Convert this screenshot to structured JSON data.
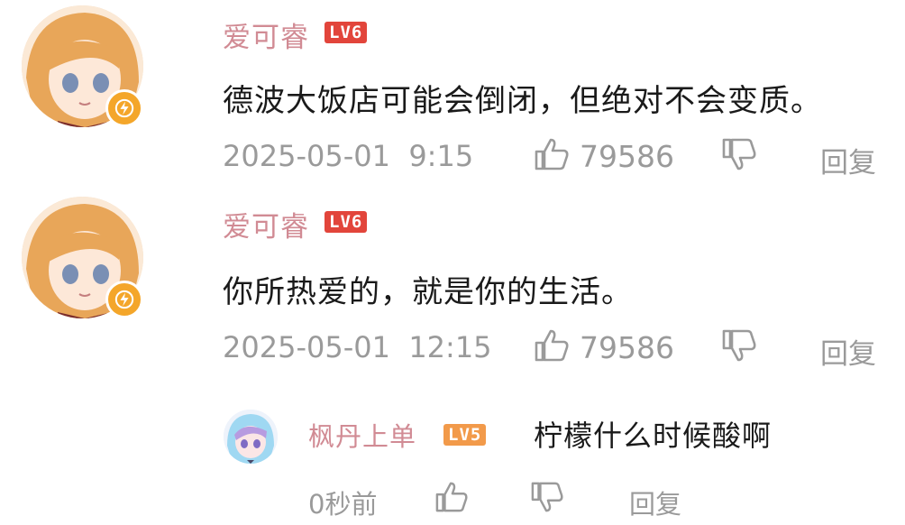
{
  "comments": [
    {
      "username": "爱可睿",
      "level": "LV6",
      "level_color": "#e2453b",
      "text": "德波大饭店可能会倒闭，但绝对不会变质。",
      "time": "2025-05-01  9:15",
      "likes": "79586",
      "reply_label": "回复"
    },
    {
      "username": "爱可睿",
      "level": "LV6",
      "level_color": "#e2453b",
      "text": "你所热爱的，就是你的生活。",
      "time": "2025-05-01  12:15",
      "likes": "79586",
      "reply_label": "回复"
    }
  ],
  "reply": {
    "username": "枫丹上单",
    "level": "LV5",
    "level_color": "#f29a4a",
    "text": "柠檬什么时候酸啊",
    "time": "0秒前",
    "reply_label": "回复"
  },
  "icons": {
    "like": "thumbs-up-icon",
    "dislike": "thumbs-down-icon",
    "badge": "lightning-icon"
  }
}
